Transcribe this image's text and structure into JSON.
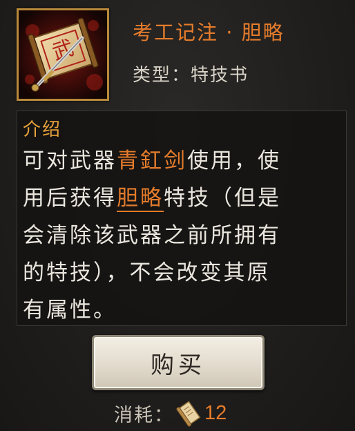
{
  "item": {
    "title": "考工记注 · 胆略",
    "type_label": "类型：",
    "type_value": "特技书",
    "icon": "scroll-with-sword-icon",
    "icon_glyph": "武"
  },
  "description": {
    "heading": "介绍",
    "line1_a": "可对武器",
    "line1_hl": "青釭剑",
    "line1_b": "使用，使",
    "line2_a": "用后获得",
    "line2_hl": "胆略",
    "line2_b": "特技（但是",
    "line3": "会清除该武器之前所拥有",
    "line4": "的特技），不会改变其原",
    "line5": "有属性。"
  },
  "buy_button": {
    "label": "购买"
  },
  "cost": {
    "label": "消耗：",
    "icon": "scroll-token-icon",
    "value": "12"
  },
  "colors": {
    "highlight": "#e67c2b",
    "heading": "#e8a23a",
    "text": "#ebe6de",
    "frame": "#b98a3b"
  }
}
